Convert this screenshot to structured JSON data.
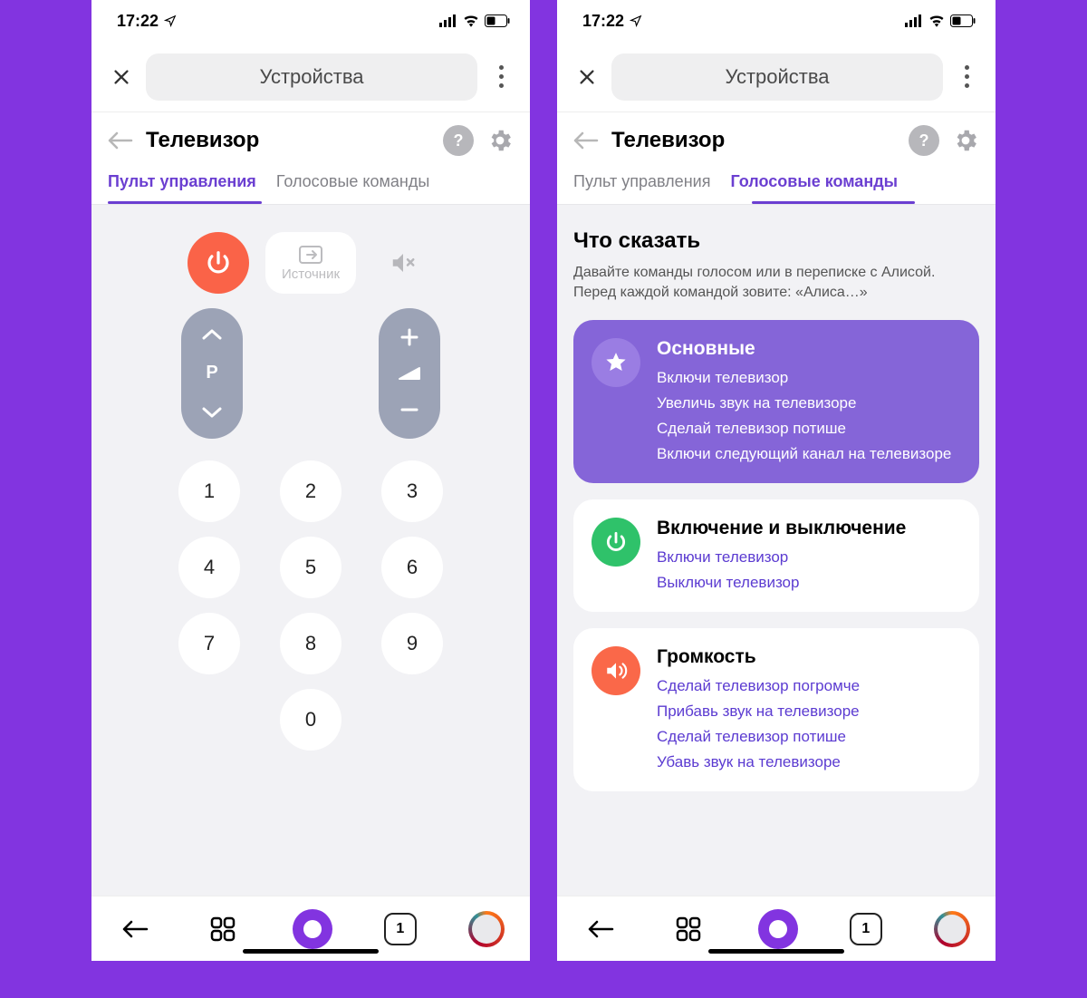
{
  "statusbar": {
    "time": "17:22"
  },
  "topnav": {
    "title": "Устройства"
  },
  "page": {
    "title": "Телевизор"
  },
  "tabs": {
    "remote": "Пульт управления",
    "voice": "Голосовые команды"
  },
  "remote": {
    "source_label": "Источник",
    "channel_label": "P",
    "numpad": [
      "1",
      "2",
      "3",
      "4",
      "5",
      "6",
      "7",
      "8",
      "9",
      "0"
    ]
  },
  "voice": {
    "heading": "Что сказать",
    "subtitle": "Давайте команды голосом или в переписке с Алисой. Перед каждой командой зовите: «Алиса…»",
    "cards": [
      {
        "title": "Основные",
        "commands": [
          "Включи телевизор",
          "Увеличь звук на телевизоре",
          "Сделай телевизор потише",
          "Включи следующий канал на телевизоре"
        ]
      },
      {
        "title": "Включение и выключение",
        "commands": [
          "Включи телевизор",
          "Выключи телевизор"
        ]
      },
      {
        "title": "Громкость",
        "commands": [
          "Сделай телевизор погромче",
          "Прибавь звук на телевизоре",
          "Сделай телевизор потише",
          "Убавь звук на телевизоре"
        ]
      }
    ]
  },
  "bottomnav": {
    "tab_count": "1"
  }
}
